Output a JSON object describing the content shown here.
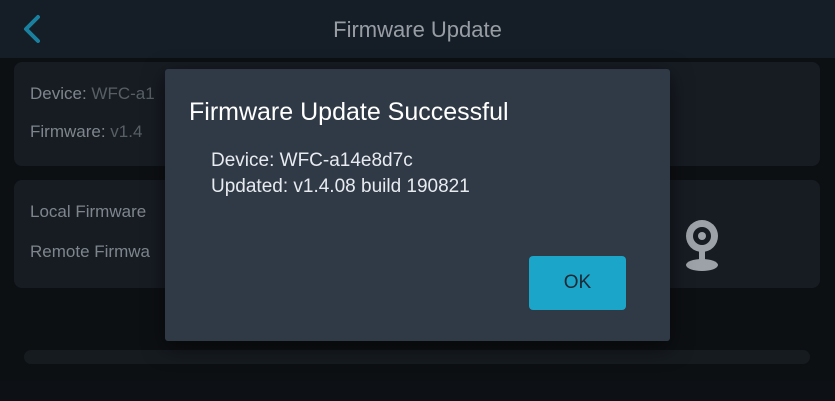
{
  "header": {
    "title": "Firmware Update",
    "back_icon": "chevron-left-icon"
  },
  "info_card": {
    "device_label": "Device:",
    "device_value": "WFC-a1",
    "firmware_label": "Firmware:",
    "firmware_value": "v1.4"
  },
  "firmware_card": {
    "local_label": "Local Firmware",
    "remote_label": "Remote Firmwa",
    "camera_icon": "webcam-icon"
  },
  "dialog": {
    "title": "Firmware Update Successful",
    "device_line": "Device: WFC-a14e8d7c",
    "updated_line": "Updated: v1.4.08 build 190821",
    "ok_label": "OK"
  },
  "colors": {
    "accent": "#1aa5c9",
    "dialog_bg": "#303a46",
    "header_bg": "#1a2430",
    "back_icon": "#1f9ec2"
  }
}
